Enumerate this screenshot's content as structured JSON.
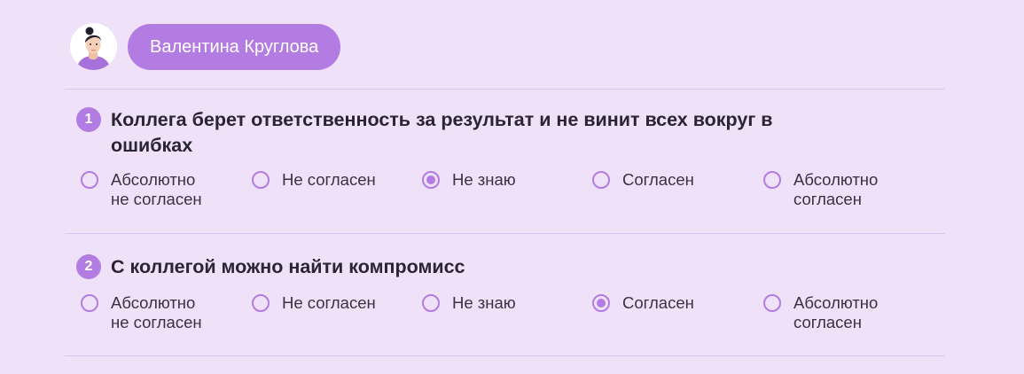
{
  "user": {
    "name": "Валентина Круглова"
  },
  "questions": [
    {
      "number": "1",
      "text": "Коллега берет ответственность за результат и не винит всех вокруг в ошибках",
      "selected": 2,
      "options": [
        "Абсолютно\nне согласен",
        "Не согласен",
        "Не знаю",
        "Согласен",
        "Абсолютно\nсогласен"
      ]
    },
    {
      "number": "2",
      "text": "С коллегой можно найти компромисс",
      "selected": 3,
      "options": [
        "Абсолютно\nне согласен",
        "Не согласен",
        "Не знаю",
        "Согласен",
        "Абсолютно\nсогласен"
      ]
    }
  ],
  "colors": {
    "accent": "#b27ce3",
    "background": "#efe1f8",
    "text": "#2a2433"
  },
  "icons": {
    "avatar": "person-avatar-icon"
  }
}
